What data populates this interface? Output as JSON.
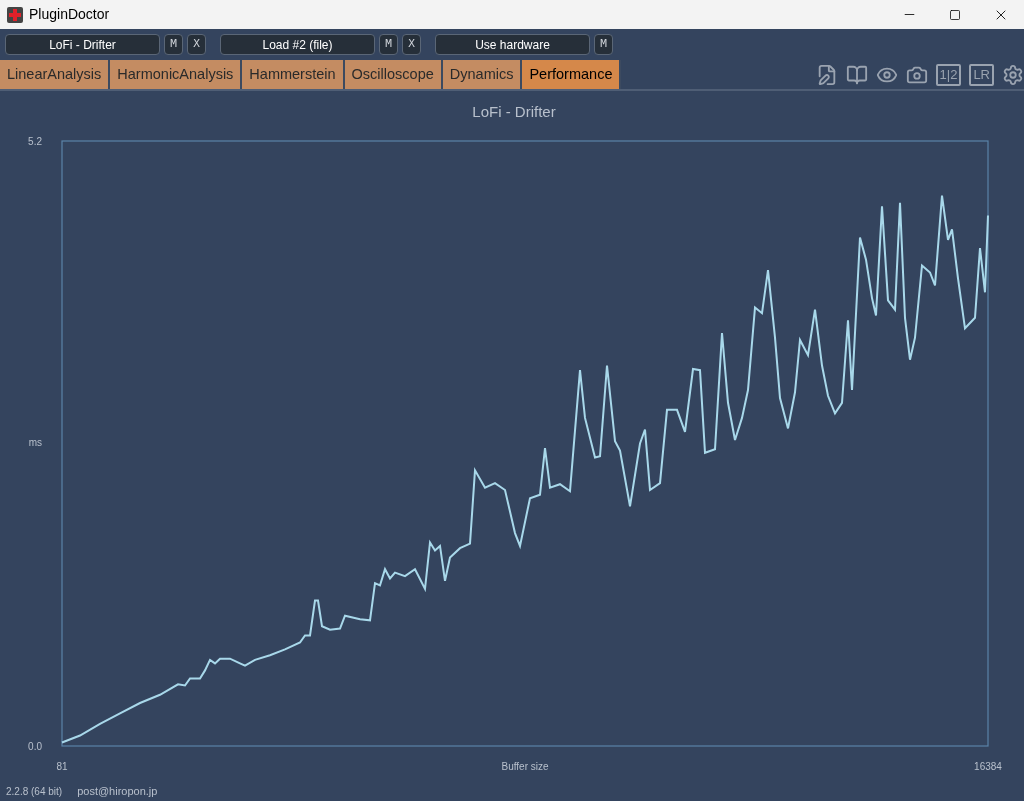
{
  "window": {
    "title": "PluginDoctor"
  },
  "slots": [
    {
      "label": "LoFi - Drifter",
      "buttons": [
        "M",
        "X"
      ]
    },
    {
      "label": "Load #2 (file)",
      "buttons": [
        "M",
        "X"
      ]
    },
    {
      "label": "Use hardware",
      "buttons": [
        "M"
      ]
    }
  ],
  "tabs": [
    {
      "label": "LinearAnalysis",
      "selected": false
    },
    {
      "label": "HarmonicAnalysis",
      "selected": false
    },
    {
      "label": "Hammerstein",
      "selected": false
    },
    {
      "label": "Oscilloscope",
      "selected": false
    },
    {
      "label": "Dynamics",
      "selected": false
    },
    {
      "label": "Performance",
      "selected": true
    }
  ],
  "toolbar": [
    {
      "kind": "notes"
    },
    {
      "kind": "book"
    },
    {
      "kind": "eye"
    },
    {
      "kind": "camera"
    },
    {
      "kind": "text",
      "label": "1|2"
    },
    {
      "kind": "text",
      "label": "LR"
    },
    {
      "kind": "gear"
    }
  ],
  "chart": {
    "chart_data": {
      "type": "line",
      "title": "LoFi - Drifter",
      "xlabel": "Buffer size",
      "ylabel": "ms",
      "xlim": [
        81,
        16384
      ],
      "ylim": [
        0,
        5.2
      ],
      "xticks": [
        81,
        16384
      ],
      "yticks": [
        {
          "value": 0,
          "label": "0.0"
        },
        {
          "value": 5.2,
          "label": "5.2"
        }
      ],
      "x": [
        81,
        398,
        750,
        1102,
        1454,
        1806,
        2123,
        2247,
        2335,
        2511,
        2599,
        2687,
        2775,
        2863,
        3039,
        3215,
        3303,
        3479,
        3743,
        4007,
        4271,
        4359,
        4447,
        4535,
        4588,
        4659,
        4799,
        4975,
        5063,
        5328,
        5504,
        5592,
        5680,
        5768,
        5856,
        5944,
        6120,
        6296,
        6472,
        6560,
        6648,
        6736,
        6824,
        6912,
        7088,
        7264,
        7352,
        7528,
        7704,
        7880,
        8057,
        8145,
        8321,
        8497,
        8585,
        8673,
        8849,
        9025,
        9201,
        9289,
        9465,
        9553,
        9676,
        9817,
        9905,
        10081,
        10257,
        10345,
        10433,
        10609,
        10733,
        10909,
        11050,
        11190,
        11314,
        11402,
        11578,
        11701,
        11807,
        11930,
        12053,
        12159,
        12282,
        12405,
        12511,
        12634,
        12722,
        12863,
        12986,
        13074,
        13215,
        13338,
        13462,
        13567,
        13691,
        13814,
        13919,
        13990,
        14131,
        14236,
        14342,
        14412,
        14518,
        14624,
        14747,
        14835,
        14923,
        15011,
        15099,
        15222,
        15363,
        15451,
        15574,
        15680,
        15750,
        15856,
        15979,
        16155,
        16243,
        16331,
        16384
      ],
      "series": [
        {
          "color": "#a8d8ea",
          "values": [
            0.03,
            0.09,
            0.19,
            0.28,
            0.37,
            0.44,
            0.53,
            0.52,
            0.58,
            0.58,
            0.65,
            0.74,
            0.71,
            0.75,
            0.75,
            0.71,
            0.69,
            0.74,
            0.78,
            0.83,
            0.89,
            0.95,
            0.95,
            1.25,
            1.25,
            1.03,
            1.0,
            1.01,
            1.12,
            1.09,
            1.08,
            1.4,
            1.38,
            1.52,
            1.44,
            1.49,
            1.46,
            1.52,
            1.35,
            1.75,
            1.68,
            1.72,
            1.42,
            1.62,
            1.7,
            1.74,
            2.37,
            2.22,
            2.26,
            2.2,
            1.83,
            1.72,
            2.13,
            2.16,
            2.56,
            2.22,
            2.25,
            2.19,
            3.23,
            2.82,
            2.48,
            2.49,
            3.27,
            2.62,
            2.54,
            2.06,
            2.6,
            2.72,
            2.2,
            2.26,
            2.89,
            2.89,
            2.7,
            3.24,
            3.23,
            2.52,
            2.55,
            3.55,
            2.95,
            2.63,
            2.82,
            3.06,
            3.77,
            3.72,
            4.09,
            3.51,
            2.99,
            2.73,
            3.04,
            3.49,
            3.36,
            3.75,
            3.27,
            3.01,
            2.86,
            2.95,
            3.66,
            3.06,
            4.37,
            4.18,
            3.85,
            3.7,
            4.64,
            3.83,
            3.75,
            4.67,
            3.68,
            3.32,
            3.51,
            4.13,
            4.07,
            3.96,
            4.73,
            4.35,
            4.44,
            4.02,
            3.59,
            3.68,
            4.28,
            3.9,
            4.56
          ]
        }
      ]
    }
  },
  "status_bar": {
    "version": "2.2.8 (64 bit)",
    "contact": "post@hiropon.jp"
  }
}
